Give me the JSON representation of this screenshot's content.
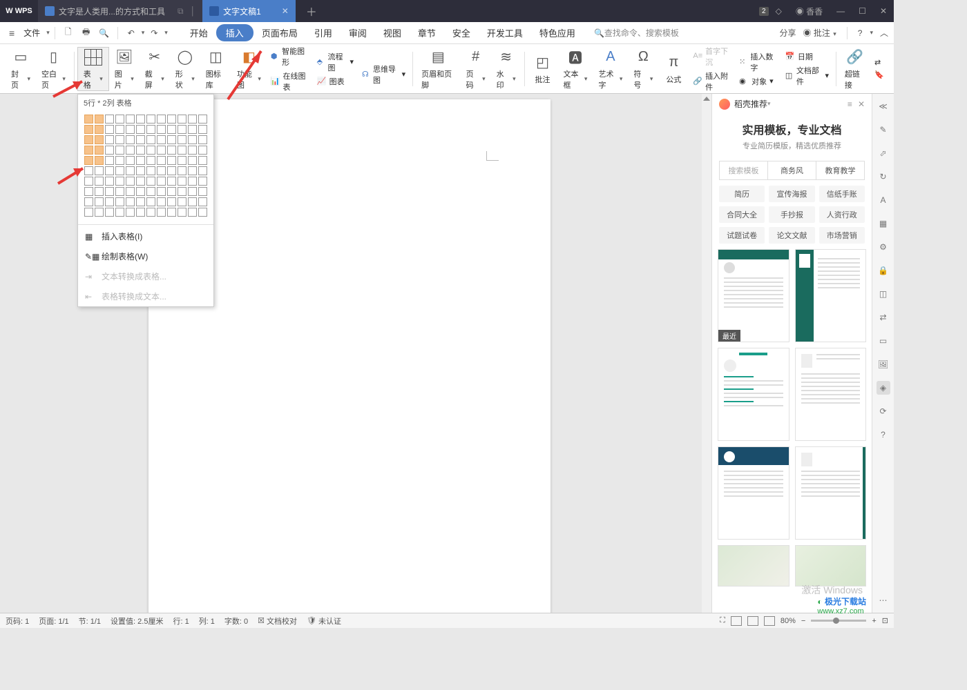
{
  "titlebar": {
    "logo": "WPS",
    "tab1": "文字是人类用...的方式和工具",
    "tab2": "文字文稿1",
    "badge": "2",
    "user": "香香"
  },
  "menubar": {
    "file": "文件",
    "tabs": [
      "开始",
      "插入",
      "页面布局",
      "引用",
      "审阅",
      "视图",
      "章节",
      "安全",
      "开发工具",
      "特色应用"
    ],
    "search": "查找命令、搜索模板",
    "share": "分享",
    "comment": "批注"
  },
  "ribbon": {
    "cover": "封页",
    "blank": "空白页",
    "table": "表格",
    "picture": "图片",
    "screenshot": "截屏",
    "shapes": "形状",
    "iconlib": "图标库",
    "funcimg": "功能图",
    "smartart": "智能图形",
    "onlinechart": "在线图表",
    "flowchart": "流程图",
    "chart": "图表",
    "mindmap": "思维导图",
    "headerfooter": "页眉和页脚",
    "pagenum": "页码",
    "watermark": "水印",
    "annotation": "批注",
    "textbox": "文本框",
    "wordart": "艺术字",
    "symbol": "符号",
    "formula": "公式",
    "firstdrop": "首字下沉",
    "insertnum": "插入数字",
    "attachment": "插入附件",
    "object": "对象",
    "date": "日期",
    "docparts": "文档部件",
    "hyperlink": "超链接"
  },
  "table_dropdown": {
    "header": "5行 * 2列 表格",
    "sel_rows": 5,
    "sel_cols": 2,
    "insert": "插入表格(I)",
    "draw": "绘制表格(W)",
    "text2table": "文本转换成表格...",
    "table2text": "表格转换成文本..."
  },
  "right_panel": {
    "title": "稻壳推荐",
    "banner_t1": "实用模板，专业文档",
    "banner_t2": "专业简历模版，精选优质推荐",
    "tabs": [
      "搜索模板",
      "商务风",
      "教育教学"
    ],
    "cats": [
      "简历",
      "宣传海报",
      "信纸手账",
      "合同大全",
      "手抄报",
      "人资行政",
      "试题试卷",
      "论文文献",
      "市场营销"
    ],
    "recent": "最近"
  },
  "statusbar": {
    "page_no": "页码: 1",
    "page": "页面: 1/1",
    "section": "节: 1/1",
    "setting": "设置值: 2.5厘米",
    "row": "行: 1",
    "col": "列: 1",
    "words": "字数: 0",
    "proof": "文档校对",
    "unauth": "未认证",
    "zoom": "80%"
  },
  "watermark": {
    "activate": "激活 Windows",
    "xz1": "极光下载站",
    "xz2": "www.xz7.com"
  }
}
